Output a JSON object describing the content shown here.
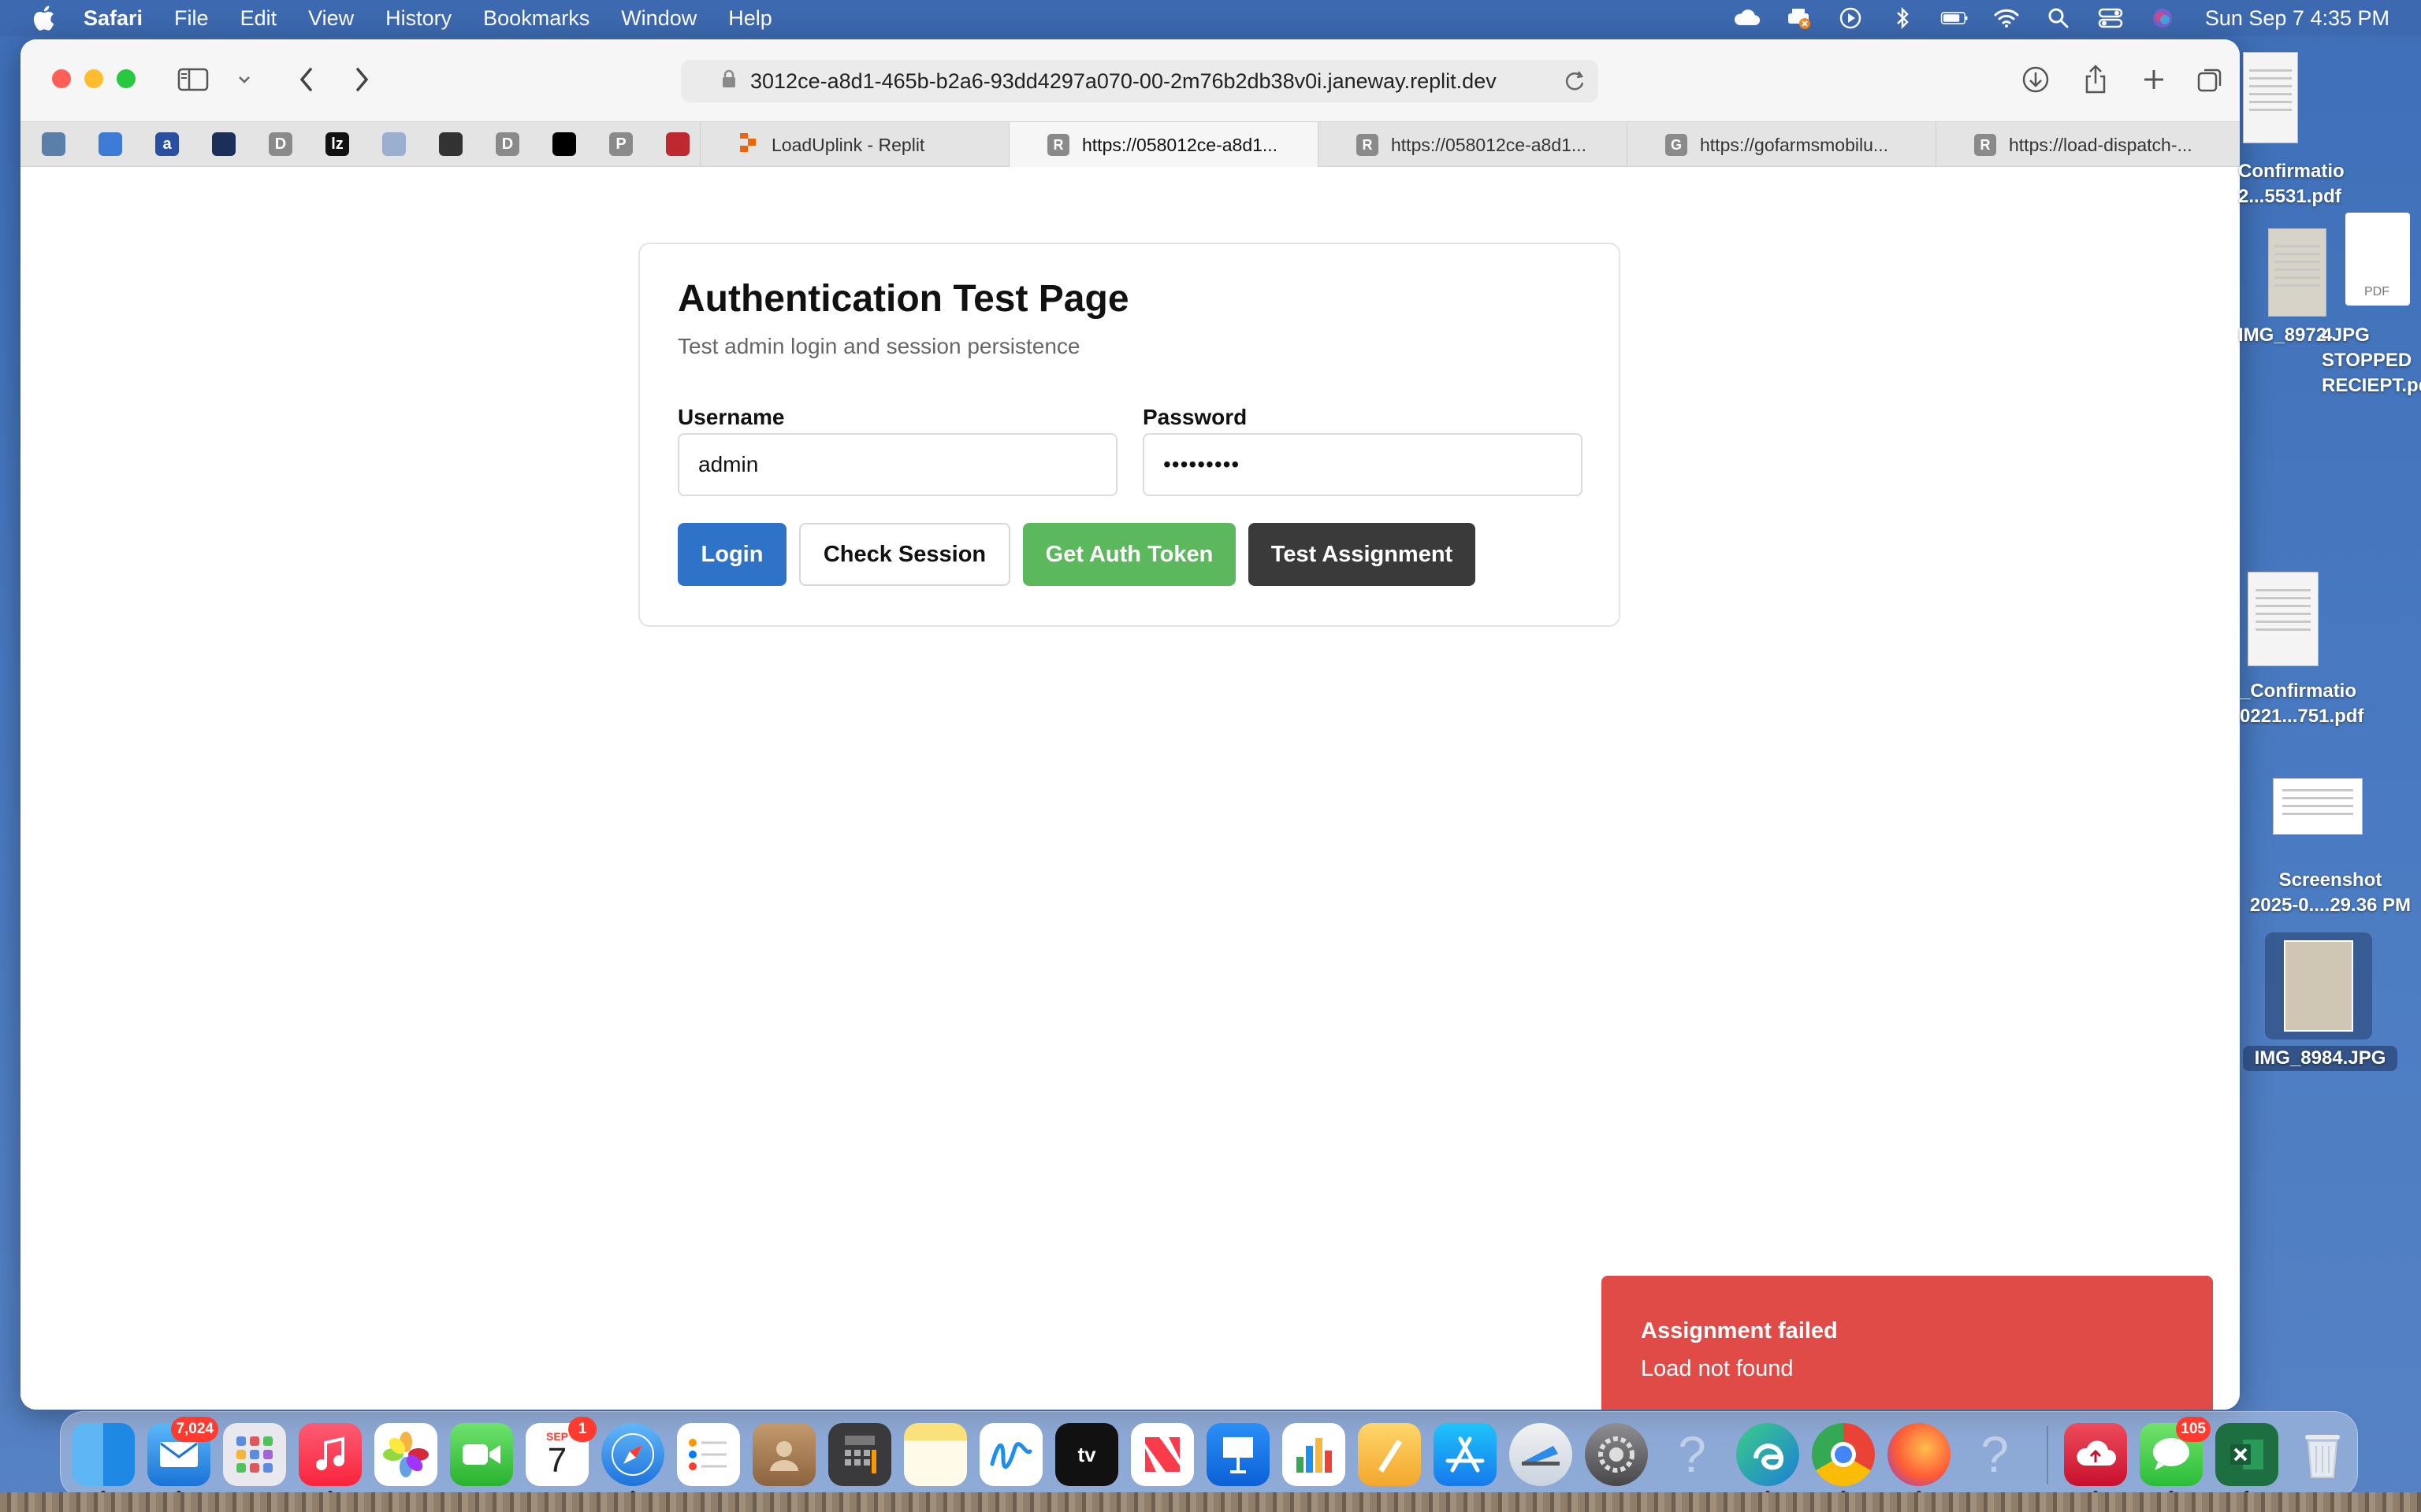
{
  "menubar": {
    "app_name": "Safari",
    "items": [
      "File",
      "Edit",
      "View",
      "History",
      "Bookmarks",
      "Window",
      "Help"
    ],
    "clock": "Sun Sep 7  4:35 PM"
  },
  "browser": {
    "url": "3012ce-a8d1-465b-b2a6-93dd4297a070-00-2m76b2db38v0i.janeway.replit.dev",
    "favorites": [
      {
        "icon": "diamond-icon",
        "letter": "",
        "color": "#5a7fa8"
      },
      {
        "icon": "rocket-icon",
        "letter": "",
        "color": "#3e7bd6"
      },
      {
        "icon": "a-logo-icon",
        "letter": "a",
        "color": "#2a4fa0"
      },
      {
        "icon": "sail-icon",
        "letter": "",
        "color": "#1b2f5a"
      },
      {
        "icon": "d-icon",
        "letter": "D",
        "color": "#8a8a8a"
      },
      {
        "icon": "lz-icon",
        "letter": "lz",
        "color": "#111111"
      },
      {
        "icon": "doc-icon",
        "letter": "",
        "color": "#9bb0d0"
      },
      {
        "icon": "plane-icon",
        "letter": "",
        "color": "#333333"
      },
      {
        "icon": "d-icon",
        "letter": "D",
        "color": "#8a8a8a"
      },
      {
        "icon": "signature-icon",
        "letter": "",
        "color": "#000000"
      },
      {
        "icon": "p-icon",
        "letter": "P",
        "color": "#8a8a8a"
      },
      {
        "icon": "star-badge-icon",
        "letter": "",
        "color": "#c0282f"
      }
    ],
    "tabs": [
      {
        "label": "LoadUplink - Replit",
        "icon_letter": "",
        "active": false
      },
      {
        "label": "https://058012ce-a8d1...",
        "icon_letter": "R",
        "active": true
      },
      {
        "label": "https://058012ce-a8d1...",
        "icon_letter": "R",
        "active": false
      },
      {
        "label": "https://gofarmsmobilu...",
        "icon_letter": "G",
        "active": false
      },
      {
        "label": "https://load-dispatch-...",
        "icon_letter": "R",
        "active": false
      }
    ]
  },
  "page": {
    "title": "Authentication Test Page",
    "subtitle": "Test admin login and session persistence",
    "username_label": "Username",
    "username_value": "admin",
    "password_label": "Password",
    "password_value": "•••••••••",
    "buttons": {
      "login": "Login",
      "check_session": "Check Session",
      "get_auth_token": "Get Auth Token",
      "test_assignment": "Test Assignment"
    },
    "toast": {
      "title": "Assignment failed",
      "message": "Load not found"
    }
  },
  "desktop": {
    "files": [
      {
        "line1": "Confirmatio",
        "line2": "2...5531.pdf"
      },
      {
        "line1": "IMG_8972.JPG",
        "line2": ""
      },
      {
        "line1": "4 STOPPED",
        "line2": "RECIEPT.pdf"
      },
      {
        "line1": "_Confirmatio",
        "line2": "0221...751.pdf"
      },
      {
        "line1": "Screenshot",
        "line2": "2025-0....29.36 PM"
      },
      {
        "line1": "IMG_8984.JPG",
        "line2": ""
      }
    ],
    "doc_badge": "PDF"
  },
  "dock": {
    "badges": {
      "mail": "7,024",
      "calendar": "1",
      "messages": "105"
    },
    "calendar_month": "SEP",
    "calendar_day": "7",
    "tv_label": "tv"
  }
}
